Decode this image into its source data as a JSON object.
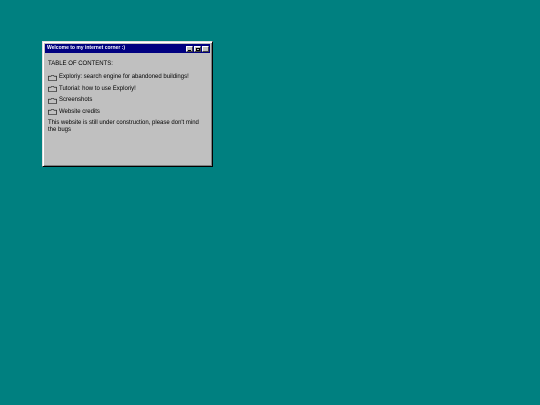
{
  "window": {
    "title": "Welcome to my internet corner :)",
    "buttons": {
      "minimize": "minimize",
      "maximize": "maximize",
      "close": "close"
    }
  },
  "toc": {
    "heading": "TABLE OF CONTENTS:",
    "items": [
      {
        "label": "Exploriy: search engine for abandoned buildings!",
        "icon": "folder-icon"
      },
      {
        "label": "Tutorial: how to use Exploriy!",
        "icon": "folder-icon"
      },
      {
        "label": "Screenshots",
        "icon": "folder-icon"
      },
      {
        "label": "Website credits",
        "icon": "folder-icon"
      }
    ]
  },
  "notice": "This website is still under construction, please don't mind the bugs",
  "colors": {
    "desktop": "#008080",
    "titlebar": "#000080",
    "window": "#c0c0c0"
  }
}
